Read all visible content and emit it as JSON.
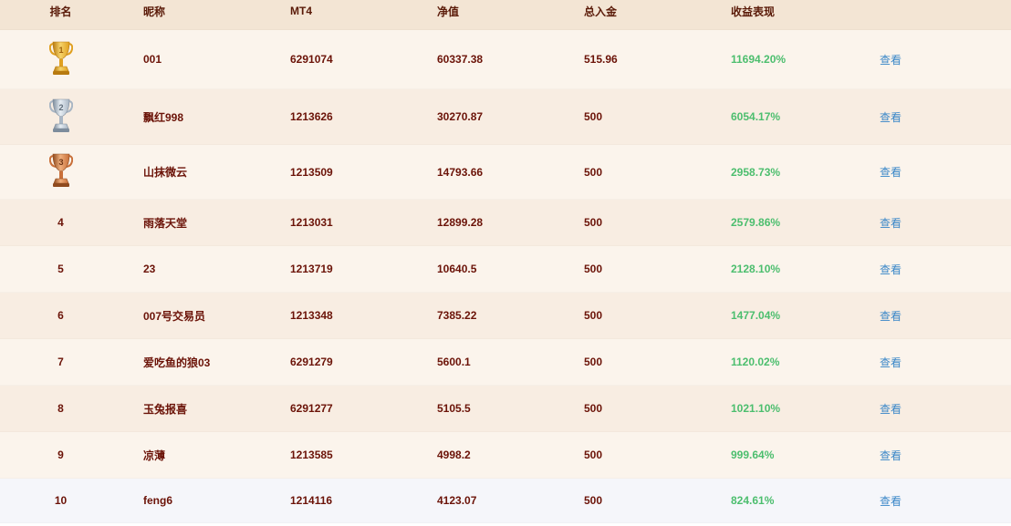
{
  "header": {
    "rank": "排名",
    "nickname": "昵称",
    "mt4": "MT4",
    "equity": "净值",
    "deposit": "总入金",
    "return": "收益表现"
  },
  "rows": [
    {
      "rank": "",
      "trophy": "gold",
      "nickname": "001",
      "mt4": "6291074",
      "equity": "60337.38",
      "deposit": "515.96",
      "return": "11694.20%",
      "action": "查看"
    },
    {
      "rank": "",
      "trophy": "silver",
      "nickname": "飘红998",
      "mt4": "1213626",
      "equity": "30270.87",
      "deposit": "500",
      "return": "6054.17%",
      "action": "查看"
    },
    {
      "rank": "",
      "trophy": "bronze",
      "nickname": "山抹微云",
      "mt4": "1213509",
      "equity": "14793.66",
      "deposit": "500",
      "return": "2958.73%",
      "action": "查看"
    },
    {
      "rank": "4",
      "nickname": "雨落天堂",
      "mt4": "1213031",
      "equity": "12899.28",
      "deposit": "500",
      "return": "2579.86%",
      "action": "查看"
    },
    {
      "rank": "5",
      "nickname": "23",
      "mt4": "1213719",
      "equity": "10640.5",
      "deposit": "500",
      "return": "2128.10%",
      "action": "查看"
    },
    {
      "rank": "6",
      "nickname": "007号交易员",
      "mt4": "1213348",
      "equity": "7385.22",
      "deposit": "500",
      "return": "1477.04%",
      "action": "查看"
    },
    {
      "rank": "7",
      "nickname": "爱吃鱼的狼03",
      "mt4": "6291279",
      "equity": "5600.1",
      "deposit": "500",
      "return": "1120.02%",
      "action": "查看"
    },
    {
      "rank": "8",
      "nickname": "玉兔报喜",
      "mt4": "6291277",
      "equity": "5105.5",
      "deposit": "500",
      "return": "1021.10%",
      "action": "查看"
    },
    {
      "rank": "9",
      "nickname": "凉薄",
      "mt4": "1213585",
      "equity": "4998.2",
      "deposit": "500",
      "return": "999.64%",
      "action": "查看"
    },
    {
      "rank": "10",
      "nickname": "feng6",
      "mt4": "1214116",
      "equity": "4123.07",
      "deposit": "500",
      "return": "824.61%",
      "action": "查看"
    }
  ],
  "trophy_numbers": {
    "gold": "1",
    "silver": "2",
    "bronze": "3"
  },
  "colors": {
    "header_bg": "#f3e5d4",
    "text": "#6b1308",
    "return": "#4cbe6e",
    "link": "#3a87c8",
    "gold": "#e8a92a",
    "silver": "#a9b6c4",
    "bronze": "#c9703a"
  }
}
